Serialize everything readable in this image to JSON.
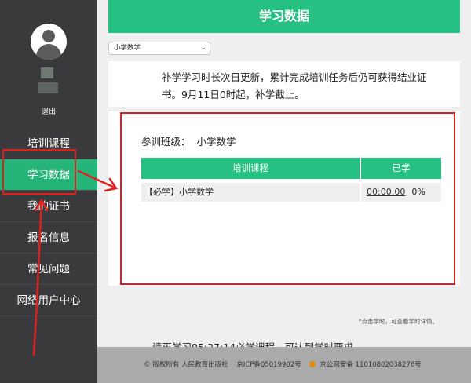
{
  "sidebar": {
    "logout_label": "退出",
    "items": [
      {
        "label": "培训课程"
      },
      {
        "label": "学习数据"
      },
      {
        "label": "我的证书"
      },
      {
        "label": "报名信息"
      },
      {
        "label": "常见问题"
      },
      {
        "label": "网络用户中心"
      }
    ],
    "active_index": 1
  },
  "header": {
    "title": "学习数据"
  },
  "class_select": {
    "value": "小学数学"
  },
  "notice": {
    "text": "补学学习时长次日更新，累计完成培训任务后仍可获得结业证书。9月11日0时起，补学截止。"
  },
  "card": {
    "class_label": "参训班级：",
    "class_value": "小学数学",
    "table": {
      "headers": [
        "培训课程",
        "已学"
      ],
      "rows": [
        {
          "course": "【必学】小学数学",
          "time": "00:00:00",
          "percent": "0%"
        }
      ]
    },
    "hint": "*点击学时，可查看学时详情。",
    "remaining": "请再学习05:27:14必学课程，可达到学时要求。"
  },
  "footer": {
    "copyright": "© 版权所有  人民教育出版社",
    "icp": "京ICP备05019902号",
    "police": "京公网安备 11010802038276号"
  },
  "colors": {
    "accent": "#26c082",
    "sidebar": "#3a3a3c",
    "annotation": "#e02020"
  }
}
